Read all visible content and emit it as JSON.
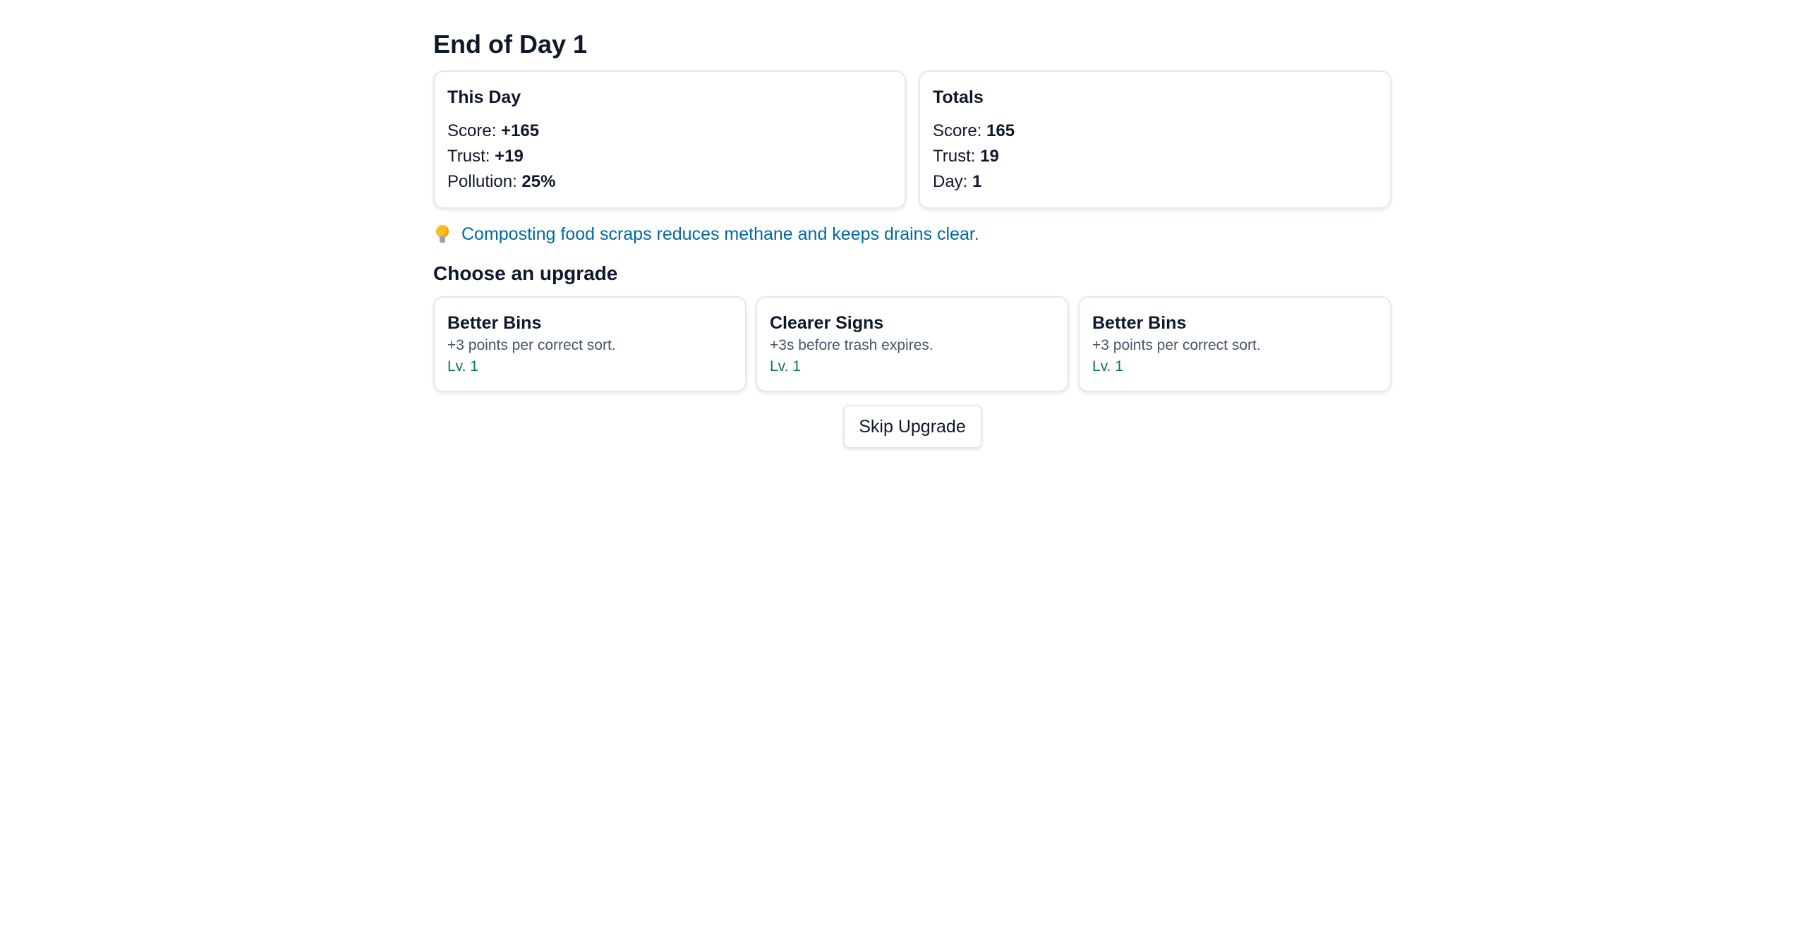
{
  "header": {
    "title": "End of Day 1"
  },
  "this_day": {
    "heading": "This Day",
    "score_label": "Score:",
    "score_value": "+165",
    "trust_label": "Trust:",
    "trust_value": "+19",
    "pollution_label": "Pollution:",
    "pollution_value": "25%"
  },
  "totals": {
    "heading": "Totals",
    "score_label": "Score:",
    "score_value": "165",
    "trust_label": "Trust:",
    "trust_value": "19",
    "day_label": "Day:",
    "day_value": "1"
  },
  "tip": {
    "icon": "lightbulb-icon",
    "text": "Composting food scraps reduces methane and keeps drains clear."
  },
  "upgrades": {
    "title": "Choose an upgrade",
    "items": [
      {
        "name": "Better Bins",
        "description": "+3 points per correct sort.",
        "level": "Lv. 1"
      },
      {
        "name": "Clearer Signs",
        "description": "+3s before trash expires.",
        "level": "Lv. 1"
      },
      {
        "name": "Better Bins",
        "description": "+3 points per correct sort.",
        "level": "Lv. 1"
      }
    ]
  },
  "actions": {
    "skip_label": "Skip Upgrade"
  },
  "colors": {
    "text": "#0f172a",
    "tip": "#0369a1",
    "level": "#047857",
    "muted": "#475569",
    "border": "#e2e8f0"
  }
}
